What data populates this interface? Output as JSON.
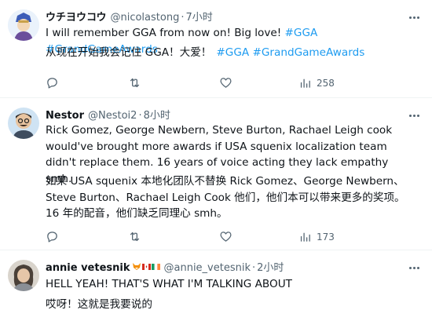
{
  "tweets": [
    {
      "name": "ウチヨウコウ",
      "handle": "@nicolastong",
      "time": "7小时",
      "text_en_plain": "I will remember GGA from now on! Big love! ",
      "text_en_tags": "#GGA #GrandGameAwards",
      "text_cn_plain": "从现在开始我会记住 GGA！大爱！",
      "text_cn_tags": "#GGA #GrandGameAwards",
      "views": "258"
    },
    {
      "name": "Nestor",
      "handle": "@Nestoi2",
      "time": "8小时",
      "text_en": "Rick Gomez, George Newbern, Steve Burton, Rachael Leigh cook would've brought more awards if USA squenix localization team didn't replace them. 16 years of voice acting they lack empathy smh.",
      "text_cn": "如果 USA squenix 本地化团队不替换 Rick Gomez、George Newbern、Steve Burton、Rachael Leigh Cook 他们，他们本可以带来更多的奖项。16 年的配音，他们缺乏同理心 smh。",
      "views": "173"
    },
    {
      "name": "annie vetesnik",
      "handle": "@annie_vetesnik",
      "time": "2小时",
      "text_en": "HELL YEAH! THAT'S WHAT I'M TALKING ABOUT",
      "text_cn": "哎呀！这就是我要说的"
    }
  ],
  "icons": {
    "reply": "reply-icon",
    "retweet": "retweet-icon",
    "like": "like-icon",
    "views": "views-icon",
    "more": "more-icon"
  },
  "colors": {
    "accent": "#1d9bf0",
    "secondary_text": "#536471",
    "divider": "#eff3f4"
  }
}
